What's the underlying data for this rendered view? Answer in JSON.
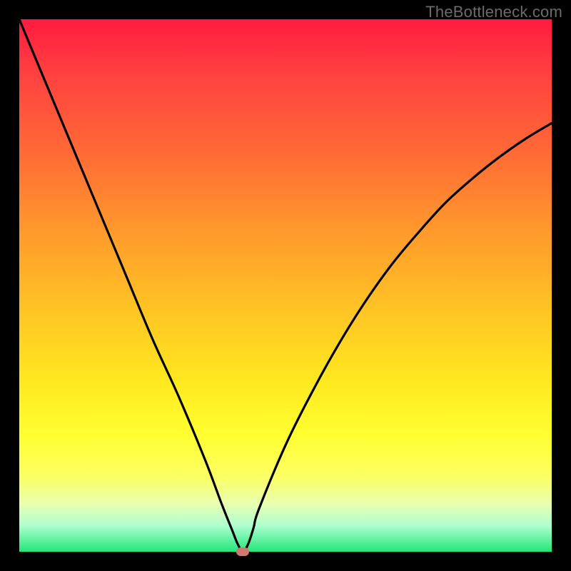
{
  "watermark": "TheBottleneck.com",
  "colors": {
    "frame": "#000000",
    "gradient_top": "#ff1b40",
    "gradient_bottom": "#22e67a",
    "curve": "#000000",
    "marker": "#cf7a70"
  },
  "chart_data": {
    "type": "line",
    "title": "",
    "xlabel": "",
    "ylabel": "",
    "xlim": [
      0,
      100
    ],
    "ylim": [
      0,
      100
    ],
    "x": [
      0,
      5,
      10,
      15,
      20,
      25,
      30,
      35,
      38,
      40,
      41,
      42,
      43,
      44,
      45,
      50,
      55,
      60,
      65,
      70,
      75,
      80,
      85,
      90,
      95,
      100
    ],
    "values": [
      100,
      88,
      76,
      64,
      52,
      40,
      29,
      17,
      9,
      4,
      1.5,
      0,
      1.5,
      4.5,
      8,
      20,
      30,
      39,
      47,
      54,
      60,
      65.5,
      70,
      74,
      77.5,
      80.5
    ],
    "minimum": {
      "x": 42,
      "y": 0
    }
  }
}
